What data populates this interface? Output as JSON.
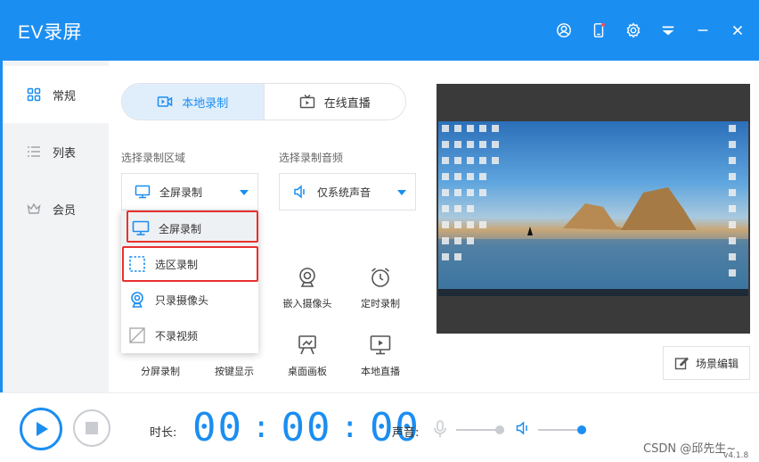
{
  "app": {
    "title": "EV录屏"
  },
  "titlebar": {
    "icons": [
      "user-icon",
      "phone-icon",
      "gear-icon",
      "menu-icon",
      "minimize-icon",
      "close-icon"
    ],
    "accent": "#1b8ef1"
  },
  "sidebar": {
    "items": [
      {
        "label": "常规",
        "icon": "grid-icon",
        "active": true
      },
      {
        "label": "列表",
        "icon": "list-icon",
        "active": false
      },
      {
        "label": "会员",
        "icon": "crown-icon",
        "active": false
      }
    ]
  },
  "mode_tabs": [
    {
      "label": "本地录制",
      "icon": "record-icon",
      "active": true
    },
    {
      "label": "在线直播",
      "icon": "tv-icon",
      "active": false
    }
  ],
  "region": {
    "label": "选择录制区域",
    "selected": "全屏录制",
    "options": [
      "全屏录制",
      "选区录制",
      "只录摄像头",
      "不录视频"
    ]
  },
  "audio": {
    "label": "选择录制音频",
    "selected": "仅系统声音"
  },
  "tools": {
    "row1": [
      {
        "label": "嵌入摄像头",
        "icon": "webcam-icon"
      },
      {
        "label": "定时录制",
        "icon": "alarm-clock-icon"
      }
    ],
    "row2": [
      {
        "label": "分屏录制",
        "icon": ""
      },
      {
        "label": "按键显示",
        "icon": ""
      },
      {
        "label": "桌面画板",
        "icon": "easel-icon"
      },
      {
        "label": "本地直播",
        "icon": "monitor-play-icon"
      }
    ]
  },
  "preview": {
    "scene_edit": "场景编辑"
  },
  "bottom": {
    "duration_label": "时长:",
    "timer": {
      "h": "00",
      "m": "00",
      "s": "00"
    },
    "volume_label": "声音:",
    "mic_level": 0.9,
    "speaker_level": 0.9
  },
  "watermark": "CSDN @邱先生~",
  "version": "v4.1.8",
  "colors": {
    "accent": "#1b8ef1",
    "highlight_border": "#e8312e",
    "sidebar_bg": "#f2f3f5"
  }
}
